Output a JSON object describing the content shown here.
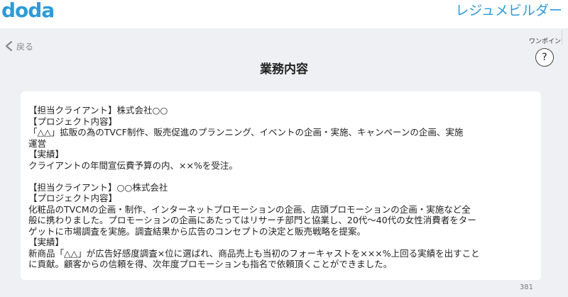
{
  "header": {
    "logo": "doda",
    "app_title": "レジュメビルダー"
  },
  "nav": {
    "back_label": "戻る"
  },
  "page": {
    "title": "業務内容",
    "onepoint_label": "ワンポイン",
    "help_label": "?"
  },
  "content": {
    "lines": [
      "【担当クライアント】株式会社○○",
      "【プロジェクト内容】",
      "「△△」拡販の為のTVCF制作、販売促進のプランニング、イベントの企画・実施、キャンペーンの企画、実施",
      "運営",
      "【実績】",
      "クライアントの年間宣伝費予算の内、××%を受注。",
      "",
      "【担当クライアント】○○株式会社",
      "【プロジェクト内容】",
      "化粧品のTVCMの企画・制作、インターネットプロモーションの企画、店頭プロモーションの企画・実施など全",
      "般に携わりました。プロモーションの企画にあたってはリサーチ部門と協業し、20代～40代の女性消費者をター",
      "ゲットに市場調査を実施。調査結果から広告のコンセプトの決定と販売戦略を提案。",
      "【実績】",
      "新商品「△△」が広告好感度調査×位に選ばれ、商品売上も当初のフォーキャストを×××%上回る実績を出すこと",
      "に貢献。顧客からの信頼を得、次年度プロモーションも指名で依頼頂くことができました。"
    ],
    "char_count": "381"
  },
  "colors": {
    "brand": "#2f9bd6",
    "background": "#eef0f3"
  }
}
